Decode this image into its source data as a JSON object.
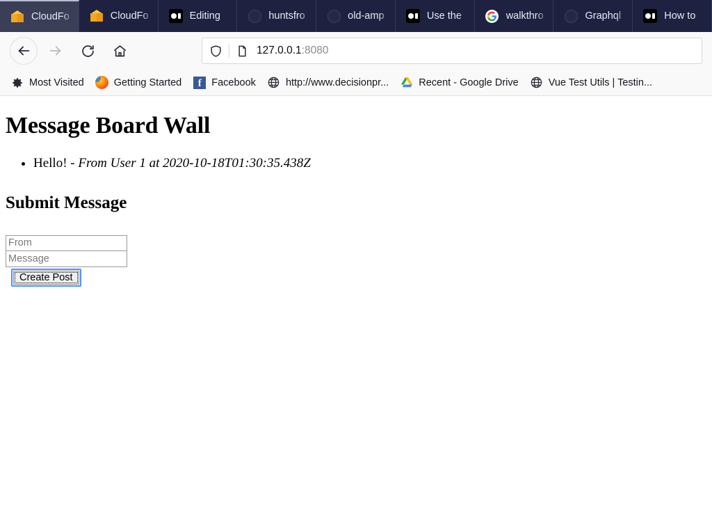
{
  "browser": {
    "tabs": [
      {
        "title": "CloudFo",
        "icon": "cube-icon",
        "active": true
      },
      {
        "title": "CloudFo",
        "icon": "cube-icon",
        "active": false
      },
      {
        "title": "Editing",
        "icon": "medium-icon",
        "active": false
      },
      {
        "title": "huntsfro",
        "icon": "github-icon",
        "active": false
      },
      {
        "title": "old-amp",
        "icon": "github-icon",
        "active": false
      },
      {
        "title": "Use the",
        "icon": "medium-icon",
        "active": false
      },
      {
        "title": "walkthro",
        "icon": "google-icon",
        "active": false
      },
      {
        "title": "Graphql",
        "icon": "github-icon",
        "active": false
      },
      {
        "title": "How to",
        "icon": "medium-icon",
        "active": false
      }
    ],
    "nav": {
      "back_label": "Back",
      "forward_label": "Forward",
      "reload_label": "Reload",
      "home_label": "Home"
    },
    "url": {
      "host": "127.0.0.1",
      "port": ":8080"
    },
    "bookmarks": [
      {
        "label": "Most Visited",
        "icon": "gear-icon"
      },
      {
        "label": "Getting Started",
        "icon": "firefox-icon"
      },
      {
        "label": "Facebook",
        "icon": "facebook-icon"
      },
      {
        "label": "http://www.decisionpr...",
        "icon": "globe-icon"
      },
      {
        "label": "Recent - Google Drive",
        "icon": "google-drive-icon"
      },
      {
        "label": "Vue Test Utils | Testin...",
        "icon": "globe-icon"
      }
    ]
  },
  "page": {
    "heading": "Message Board Wall",
    "messages": [
      {
        "text": "Hello! - ",
        "meta": "From User 1 at 2020-10-18T01:30:35.438Z"
      }
    ],
    "form": {
      "heading": "Submit Message",
      "from_placeholder": "From",
      "from_value": "",
      "message_placeholder": "Message",
      "message_value": "",
      "submit_label": "Create Post"
    }
  },
  "colors": {
    "tab_active": "#3a3e57",
    "tab_inactive": "#1e2240",
    "focus_ring": "#4d90fe",
    "chrome_bg": "#f9f9fa"
  }
}
